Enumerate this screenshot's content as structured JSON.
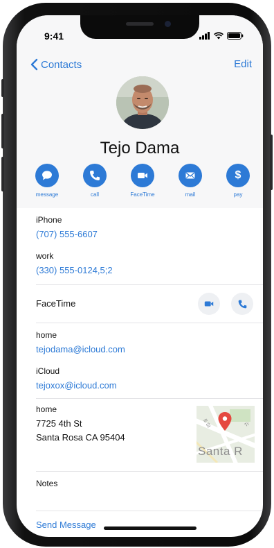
{
  "status_bar": {
    "time": "9:41"
  },
  "nav": {
    "back_label": "Contacts",
    "edit_label": "Edit"
  },
  "contact": {
    "name": "Tejo Dama"
  },
  "actions": [
    {
      "label": "message",
      "icon": "message-icon"
    },
    {
      "label": "call",
      "icon": "phone-icon"
    },
    {
      "label": "FaceTime",
      "icon": "video-icon"
    },
    {
      "label": "mail",
      "icon": "mail-icon"
    },
    {
      "label": "pay",
      "icon": "dollar-icon"
    }
  ],
  "phones": [
    {
      "label": "iPhone",
      "value": "(707) 555-6607"
    },
    {
      "label": "work",
      "value": "(330) 555-0124,5;2"
    }
  ],
  "facetime": {
    "label": "FaceTime"
  },
  "emails": [
    {
      "label": "home",
      "value": "tejodama@icloud.com"
    },
    {
      "label": "iCloud",
      "value": "tejoxox@icloud.com"
    }
  ],
  "address": {
    "label": "home",
    "line1": "7725 4th St",
    "line2": "Santa Rosa CA 95404",
    "map_text": "Santa R",
    "map_street_1": "B St",
    "map_street_2": "Tr"
  },
  "notes": {
    "label": "Notes"
  },
  "send_message": {
    "label": "Send Message"
  },
  "colors": {
    "accent": "#2d7ad6",
    "map_pin": "#e5483f"
  }
}
